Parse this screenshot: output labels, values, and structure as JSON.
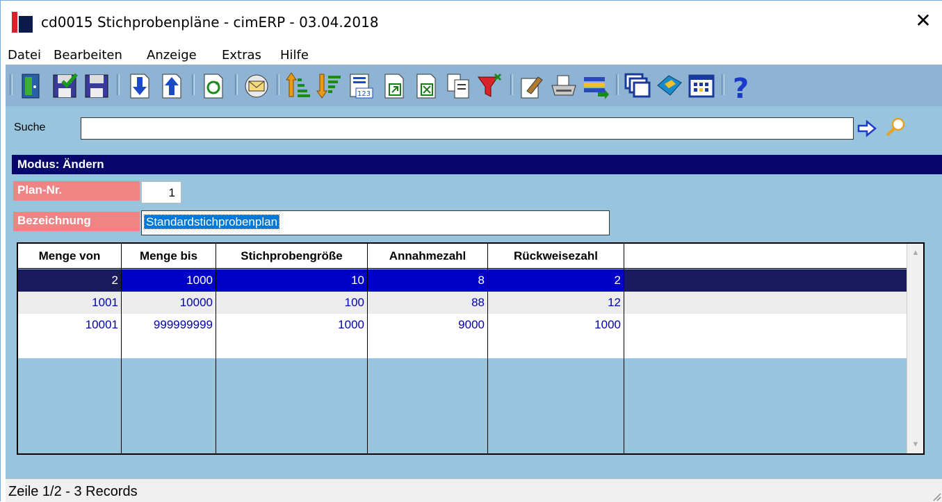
{
  "window": {
    "title": "cd0015 Stichprobenpläne - cimERP - 03.04.2018",
    "close_glyph": "✕"
  },
  "menu": {
    "items": [
      "Datei",
      "Bearbeiten",
      "Anzeige",
      "Extras",
      "Hilfe"
    ]
  },
  "toolbar": {
    "icons": [
      "exit-door-icon",
      "save-check-icon",
      "save-icon",
      "move-down-icon",
      "move-up-icon",
      "refresh-icon",
      "mail-icon",
      "sort-ascending-icon",
      "sort-descending-icon",
      "calculator-icon",
      "export-icon",
      "excel-export-icon",
      "copy-icon",
      "filter-icon",
      "edit-icon",
      "print-icon",
      "list-transfer-icon",
      "windows-icon",
      "book-icon",
      "grid-icon",
      "help-icon"
    ]
  },
  "search": {
    "label": "Suche",
    "value": ""
  },
  "mode": {
    "label": "Modus: Ändern"
  },
  "form": {
    "plan_nr_label": "Plan-Nr.",
    "plan_nr_value": "1",
    "bezeichnung_label": "Bezeichnung",
    "bezeichnung_value": "Standardstichprobenplan"
  },
  "table": {
    "columns": [
      "Menge von",
      "Menge bis",
      "Stichprobengröße",
      "Annahmezahl",
      "Rückweisezahl"
    ],
    "rows": [
      [
        "2",
        "1000",
        "10",
        "8",
        "2"
      ],
      [
        "1001",
        "10000",
        "100",
        "88",
        "12"
      ],
      [
        "10001",
        "999999999",
        "1000",
        "9000",
        "1000"
      ]
    ]
  },
  "status": {
    "text": "Zeile 1/2 - 3 Records"
  },
  "colors": {
    "toolbar_bg": "#8fb4d3",
    "content_bg": "#99c4dd",
    "mode_bar": "#06066b",
    "label_bg": "#f08383",
    "selected_row": "#0000c8",
    "cell_text": "#0000b0"
  }
}
